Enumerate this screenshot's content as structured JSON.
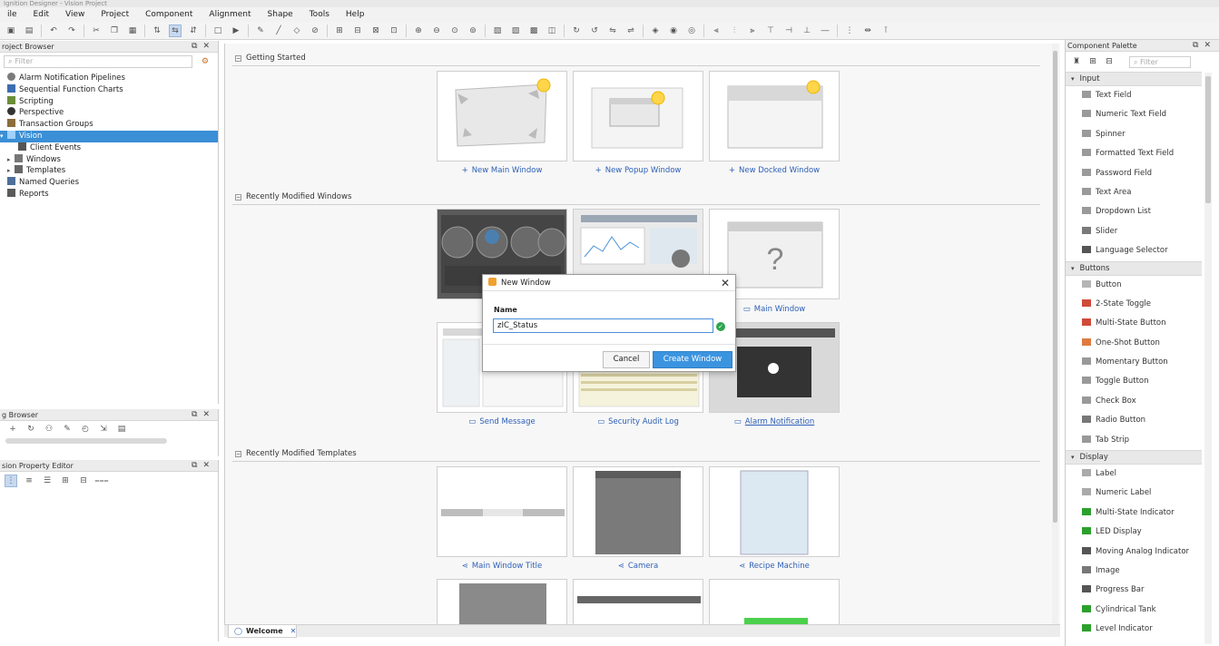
{
  "window": {
    "title": "Ignition Designer - Vision Project"
  },
  "menu": [
    "ile",
    "Edit",
    "View",
    "Project",
    "Component",
    "Alignment",
    "Shape",
    "Tools",
    "Help"
  ],
  "project_browser": {
    "title": "roject Browser",
    "filter_placeholder": "Filter",
    "items": [
      {
        "label": "Alarm Notification Pipelines",
        "icon": "alarm-pipeline-icon"
      },
      {
        "label": "Sequential Function Charts",
        "icon": "sfc-icon"
      },
      {
        "label": "Scripting",
        "icon": "script-icon"
      },
      {
        "label": "Perspective",
        "icon": "perspective-icon"
      },
      {
        "label": "Transaction Groups",
        "icon": "transaction-icon"
      },
      {
        "label": "Vision",
        "icon": "vision-icon",
        "selected": true
      },
      {
        "label": "Client Events",
        "icon": "client-events-icon"
      },
      {
        "label": "Windows",
        "icon": "folder-icon"
      },
      {
        "label": "Templates",
        "icon": "templates-icon"
      },
      {
        "label": "Named Queries",
        "icon": "query-icon"
      },
      {
        "label": "Reports",
        "icon": "report-icon"
      }
    ]
  },
  "tag_browser": {
    "title": "g Browser"
  },
  "property_editor": {
    "title": "sion Property Editor"
  },
  "welcome": {
    "sections": {
      "getting_started": "Getting Started",
      "recent_windows": "Recently Modified Windows",
      "recent_templates": "Recently Modified Templates"
    },
    "getting_started": [
      {
        "label": "New Main Window"
      },
      {
        "label": "New Popup Window"
      },
      {
        "label": "New Docked Window"
      }
    ],
    "recent_windows": [
      {
        "label": "",
        "hidden_by_dialog": true
      },
      {
        "label": "",
        "hidden_by_dialog": true
      },
      {
        "label": "Main Window"
      },
      {
        "label": "Send Message"
      },
      {
        "label": "Security Audit Log"
      },
      {
        "label": "Alarm Notification"
      }
    ],
    "recent_templates": [
      {
        "label": "Main Window Title"
      },
      {
        "label": "Camera"
      },
      {
        "label": "Recipe Machine"
      }
    ],
    "tab_label": "Welcome"
  },
  "dialog": {
    "title": "New Window",
    "field_label": "Name",
    "field_value": "zIC_Status",
    "cancel_label": "Cancel",
    "create_label": "Create Window"
  },
  "palette": {
    "title": "Component Palette",
    "filter_placeholder": "Filter",
    "groups": [
      {
        "name": "Input",
        "items": [
          "Text Field",
          "Numeric Text Field",
          "Spinner",
          "Formatted Text Field",
          "Password Field",
          "Text Area",
          "Dropdown List",
          "Slider",
          "Language Selector"
        ]
      },
      {
        "name": "Buttons",
        "items": [
          "Button",
          "2-State Toggle",
          "Multi-State Button",
          "One-Shot Button",
          "Momentary Button",
          "Toggle Button",
          "Check Box",
          "Radio Button",
          "Tab Strip"
        ]
      },
      {
        "name": "Display",
        "items": [
          "Label",
          "Numeric Label",
          "Multi-State Indicator",
          "LED Display",
          "Moving Analog Indicator",
          "Image",
          "Progress Bar",
          "Cylindrical Tank",
          "Level Indicator"
        ]
      }
    ]
  },
  "colors": {
    "selection": "#3a8fd6",
    "link": "#2d5fb5",
    "primary_button": "#3b94e0",
    "valid": "#2ea44f"
  }
}
